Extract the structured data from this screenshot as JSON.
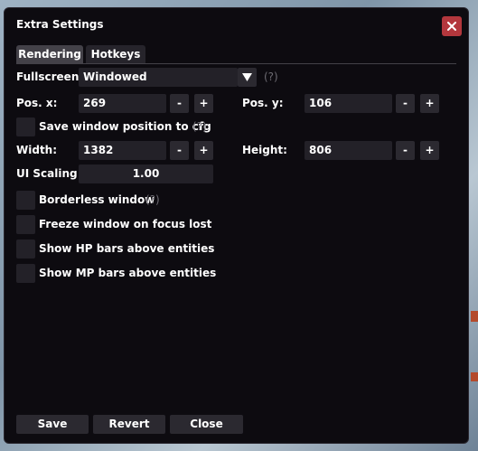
{
  "window": {
    "title": "Extra Settings"
  },
  "tabs": [
    {
      "label": "Rendering",
      "active": true
    },
    {
      "label": "Hotkeys",
      "active": false
    }
  ],
  "fullscreen": {
    "label": "Fullscreen:",
    "value": "Windowed",
    "help": "(?)"
  },
  "pos_x": {
    "label": "Pos. x:",
    "value": "269",
    "minus": "-",
    "plus": "+"
  },
  "pos_y": {
    "label": "Pos. y:",
    "value": "106",
    "minus": "-",
    "plus": "+"
  },
  "save_position": {
    "label": "Save window position to cfg",
    "help": "(?)",
    "checked": false
  },
  "width": {
    "label": "Width:",
    "value": "1382",
    "minus": "-",
    "plus": "+"
  },
  "height": {
    "label": "Height:",
    "value": "806",
    "minus": "-",
    "plus": "+"
  },
  "ui_scaling": {
    "label": "UI Scaling",
    "value": "1.00"
  },
  "options": [
    {
      "label": "Borderless window",
      "help": "(?)",
      "checked": false
    },
    {
      "label": "Freeze window on focus lost",
      "checked": false
    },
    {
      "label": "Show HP bars above entities",
      "checked": false
    },
    {
      "label": "Show MP bars above entities",
      "checked": false
    }
  ],
  "buttons": {
    "save": "Save",
    "revert": "Revert",
    "close": "Close"
  },
  "colors": {
    "window_bg": "#0d0b10",
    "close_button": "#b3373d",
    "field_bg": "#232128",
    "help_text": "#6d6b72"
  }
}
